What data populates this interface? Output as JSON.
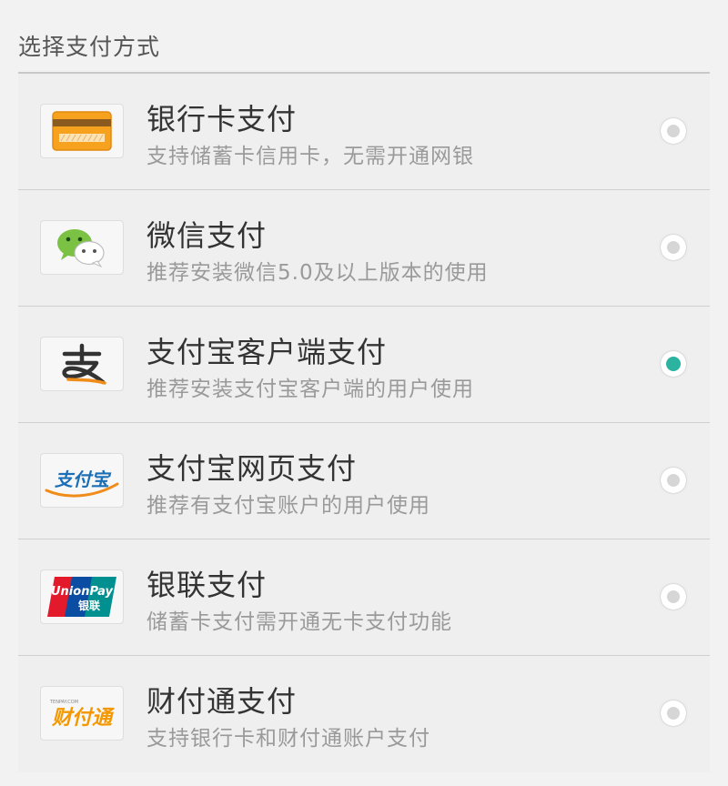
{
  "header": {
    "title": "选择支付方式"
  },
  "methods": [
    {
      "title": "银行卡支付",
      "subtitle": "支持储蓄卡信用卡，无需开通网银",
      "icon": "bank-card-icon",
      "selected": false
    },
    {
      "title": "微信支付",
      "subtitle": "推荐安装微信5.0及以上版本的使用",
      "icon": "wechat-icon",
      "selected": false
    },
    {
      "title": "支付宝客户端支付",
      "subtitle": "推荐安装支付宝客户端的用户使用",
      "icon": "alipay-app-icon",
      "selected": true
    },
    {
      "title": "支付宝网页支付",
      "subtitle": "推荐有支付宝账户的用户使用",
      "icon": "alipay-web-logo",
      "selected": false
    },
    {
      "title": "银联支付",
      "subtitle": "储蓄卡支付需开通无卡支付功能",
      "icon": "unionpay-logo",
      "selected": false
    },
    {
      "title": "财付通支付",
      "subtitle": "支持银行卡和财付通账户支付",
      "icon": "tenpay-logo",
      "selected": false
    }
  ],
  "logos": {
    "alipay_web": "支付宝",
    "unionpay_en": "UnionPay",
    "unionpay_cn": "银联",
    "tenpay_small": "TENPAY.COM",
    "tenpay_cn": "财付通"
  },
  "colors": {
    "accent": "#2bb3a0",
    "alipay_blue": "#1a6fb7",
    "alipay_orange": "#f08c1a",
    "unionpay_red": "#e21a2c",
    "unionpay_blue": "#0b4da2",
    "unionpay_teal": "#00908f",
    "tenpay_orange": "#f39800"
  }
}
